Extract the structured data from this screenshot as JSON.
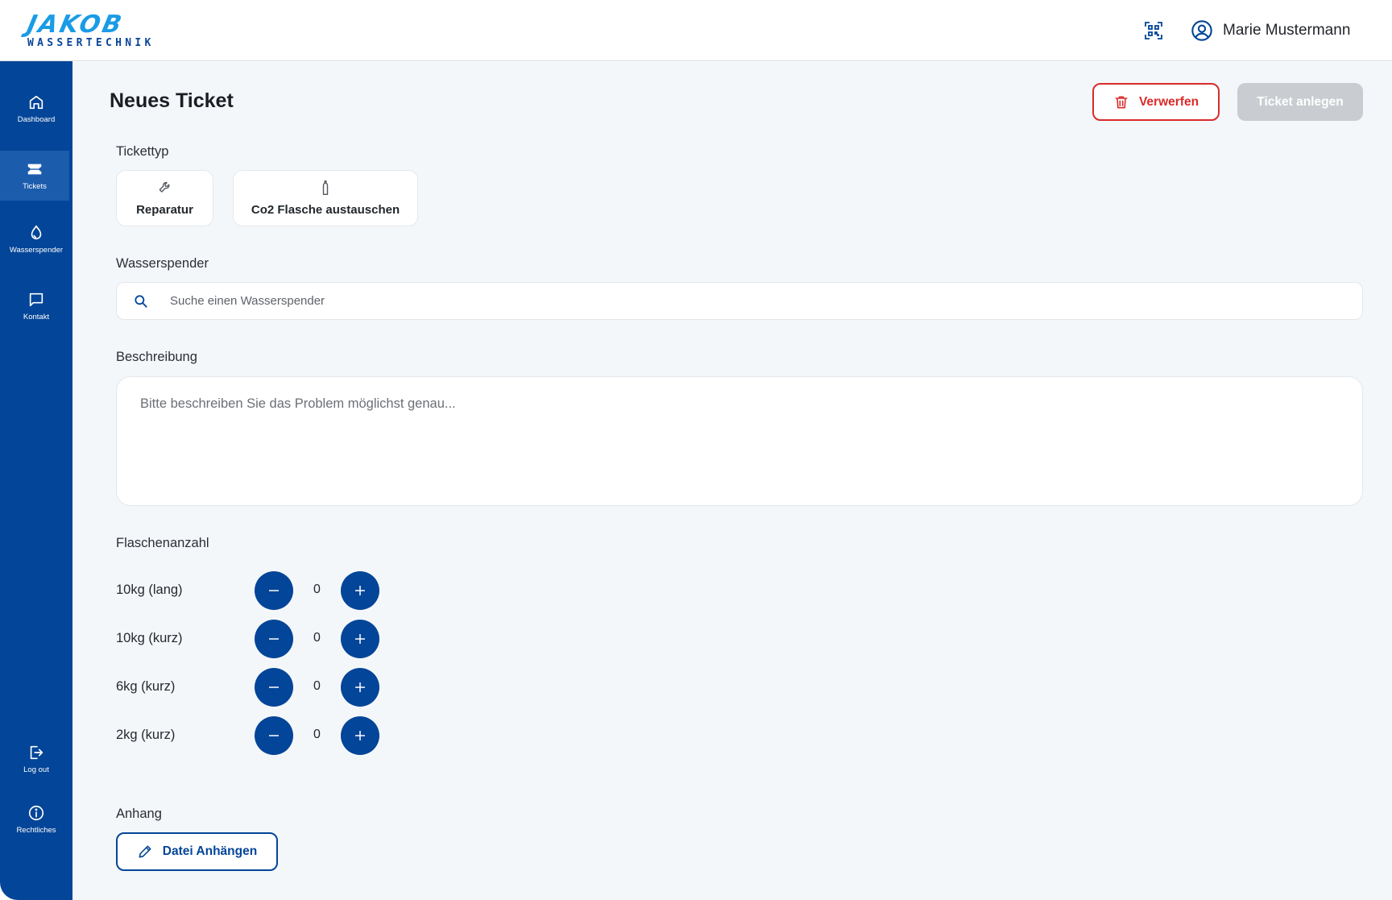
{
  "brand": {
    "name": "JAKOB",
    "subtitle": "WASSERTECHNIK"
  },
  "header": {
    "qr_icon": "qr-code-icon",
    "user_icon": "user-circle-icon",
    "user_name": "Marie Mustermann"
  },
  "sidebar": {
    "items": [
      {
        "label": "Dashboard",
        "icon": "home-icon"
      },
      {
        "label": "Tickets",
        "icon": "ticket-icon",
        "active": true
      },
      {
        "label": "Wasserspender",
        "icon": "water-drop-icon"
      },
      {
        "label": "Kontakt",
        "icon": "chat-icon"
      },
      {
        "label": "Log out",
        "icon": "logout-icon"
      },
      {
        "label": "Rechtliches",
        "icon": "info-icon"
      }
    ]
  },
  "page": {
    "title": "Neues Ticket",
    "discard_label": "Verwerfen",
    "create_label": "Ticket anlegen",
    "ticket_type": {
      "label": "Tickettyp",
      "options": [
        {
          "label": "Reparatur",
          "icon": "wrench-icon"
        },
        {
          "label": "Co2 Flasche austauschen",
          "icon": "bottle-icon"
        }
      ]
    },
    "dispenser": {
      "label": "Wasserspender",
      "placeholder": "Suche einen Wasserspender",
      "value": ""
    },
    "description": {
      "label": "Beschreibung",
      "placeholder": "Bitte beschreiben Sie das Problem möglichst genau...",
      "value": ""
    },
    "bottles": {
      "label": "Flaschenanzahl",
      "rows": [
        {
          "label": "10kg (lang)",
          "count": "0"
        },
        {
          "label": "10kg (kurz)",
          "count": "0"
        },
        {
          "label": "6kg (kurz)",
          "count": "0"
        },
        {
          "label": "2kg (kurz)",
          "count": "0"
        }
      ]
    },
    "attachment": {
      "label": "Anhang",
      "button_label": "Datei Anhängen"
    }
  },
  "colors": {
    "primary": "#034598",
    "accent": "#1a9be6",
    "danger": "#db2b2b",
    "disabled": "#c9cdd1",
    "background": "#f4f7fa"
  }
}
